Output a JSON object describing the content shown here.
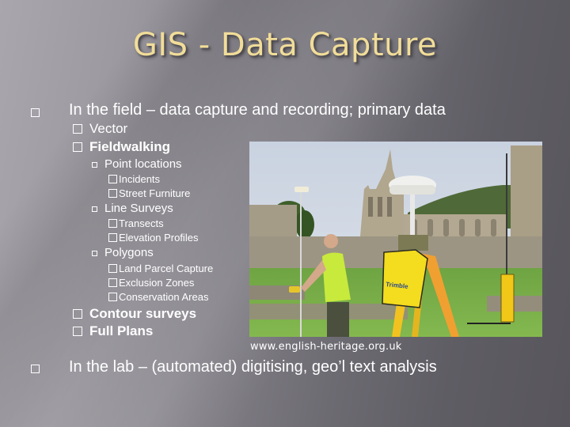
{
  "slide": {
    "title": "GIS - Data Capture",
    "bullets": [
      {
        "text": "In the field – data capture and recording; primary data",
        "children": [
          {
            "text": "Vector"
          },
          {
            "text": "Fieldwalking",
            "children": [
              {
                "text": "Point locations",
                "children": [
                  "Incidents",
                  "Street Furniture"
                ]
              },
              {
                "text": "Line Surveys",
                "children": [
                  "Transects",
                  "Elevation Profiles"
                ]
              },
              {
                "text": "Polygons",
                "children": [
                  "Land Parcel Capture",
                  "Exclusion Zones",
                  "Conservation Areas"
                ]
              }
            ]
          },
          {
            "text": "Contour surveys"
          },
          {
            "text": "Full Plans"
          }
        ]
      },
      {
        "text": "In the lab – (automated) digitising, geo’l text analysis"
      }
    ]
  },
  "photo": {
    "description": "Surveyor with GPS pole and Trimble base station tripod in front of abbey ruins",
    "bag_brand": "Trimble",
    "credit": "www.english-heritage.org.uk"
  },
  "colors": {
    "title": "#f1dd99",
    "text": "#ffffff",
    "background": "#65636a"
  }
}
